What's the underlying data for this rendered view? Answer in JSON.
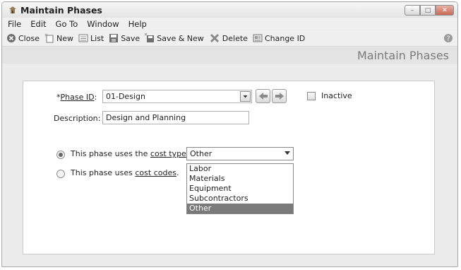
{
  "window": {
    "title": "Maintain Phases"
  },
  "menu": [
    "File",
    "Edit",
    "Go To",
    "Window",
    "Help"
  ],
  "toolbar": {
    "close": "Close",
    "new": "New",
    "list": "List",
    "save": "Save",
    "save_new": "Save & New",
    "delete": "Delete",
    "change_id": "Change ID"
  },
  "form": {
    "title": "Maintain Phases",
    "phase_id_label_prefix": "*",
    "phase_id_label": "Phase ID",
    "phase_id_value": "01-Design",
    "inactive_label": "Inactive",
    "description_label": "Description:",
    "description_value": "Design and Planning",
    "radio_cost_type_prefix": "This phase uses the ",
    "radio_cost_type_link": "cost type",
    "radio_cost_codes_prefix": "This phase uses ",
    "radio_cost_codes_link": "cost codes",
    "radio_cost_codes_suffix": ".",
    "cost_type_selected": "Other",
    "cost_type_options": [
      "Labor",
      "Materials",
      "Equipment",
      "Subcontractors",
      "Other"
    ]
  },
  "colors": {
    "list_highlight": "#7a7a7a",
    "header_text": "#7a7a7a"
  }
}
